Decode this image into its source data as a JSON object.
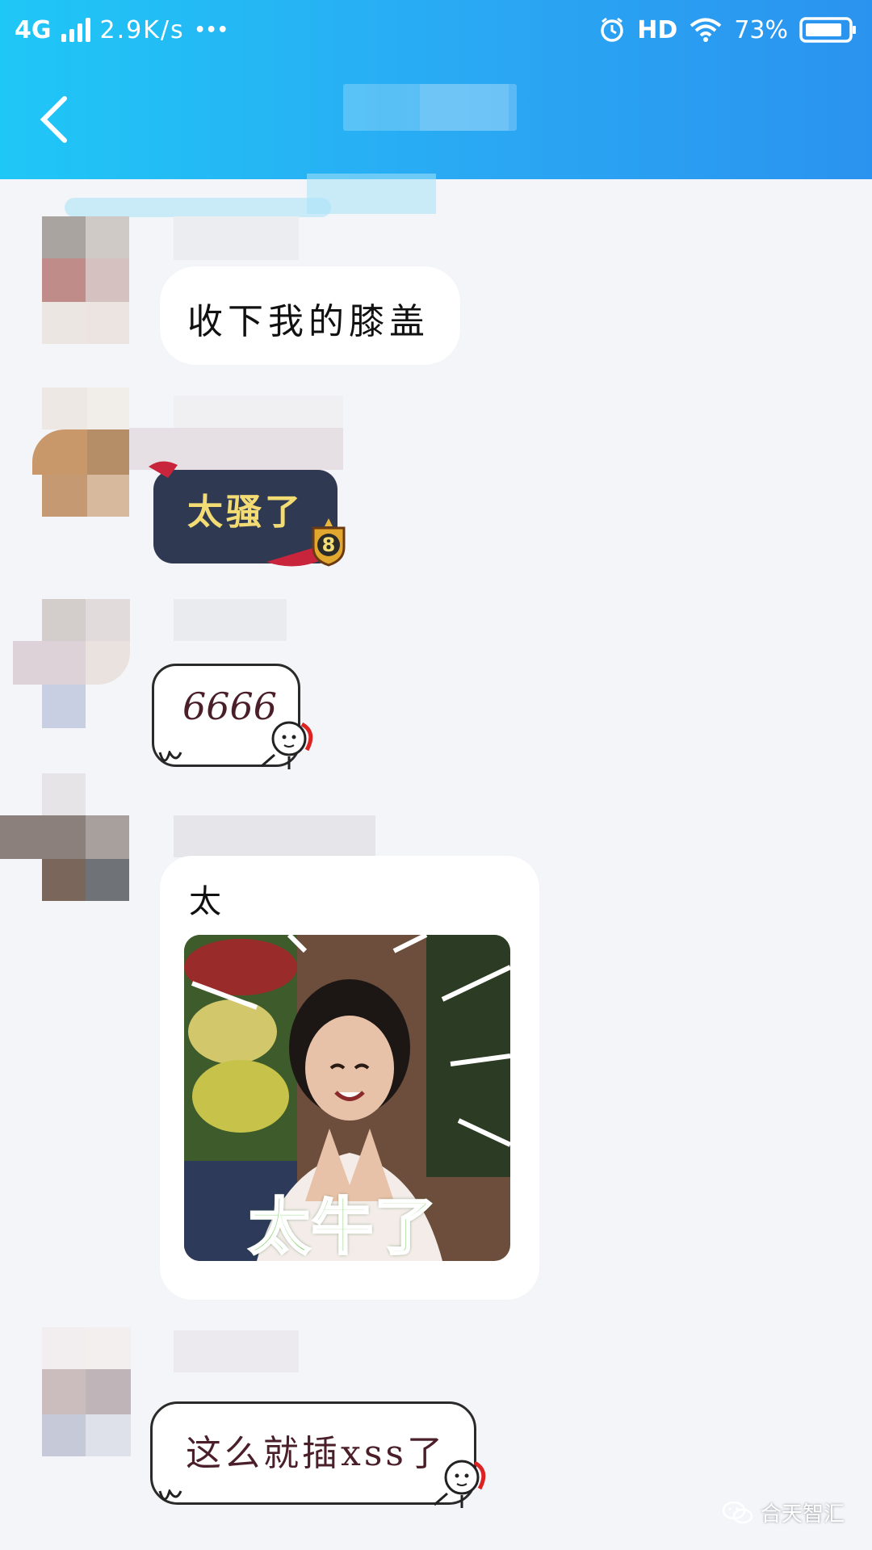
{
  "status_bar": {
    "network": "4G",
    "speed": "2.9K/s",
    "more": "•••",
    "hd": "HD",
    "battery": "73%"
  },
  "header": {
    "back_icon": "chevron-left-icon"
  },
  "messages": [
    {
      "type": "text",
      "text": "收下我的膝盖"
    },
    {
      "type": "styled",
      "text": "太骚了",
      "badge": "8"
    },
    {
      "type": "doodle",
      "text": "6666"
    },
    {
      "type": "image",
      "caption": "太",
      "image_text": "太牛了"
    },
    {
      "type": "doodle",
      "text": "这么就插xss了"
    }
  ],
  "watermark": {
    "icon": "wechat-icon",
    "text": "合天智汇"
  },
  "colors": {
    "header_start": "#1fc7f6",
    "header_end": "#2a93ef",
    "background": "#f4f5f9",
    "dark_bubble": "#2f3a52",
    "dark_bubble_text": "#f3dc74"
  }
}
